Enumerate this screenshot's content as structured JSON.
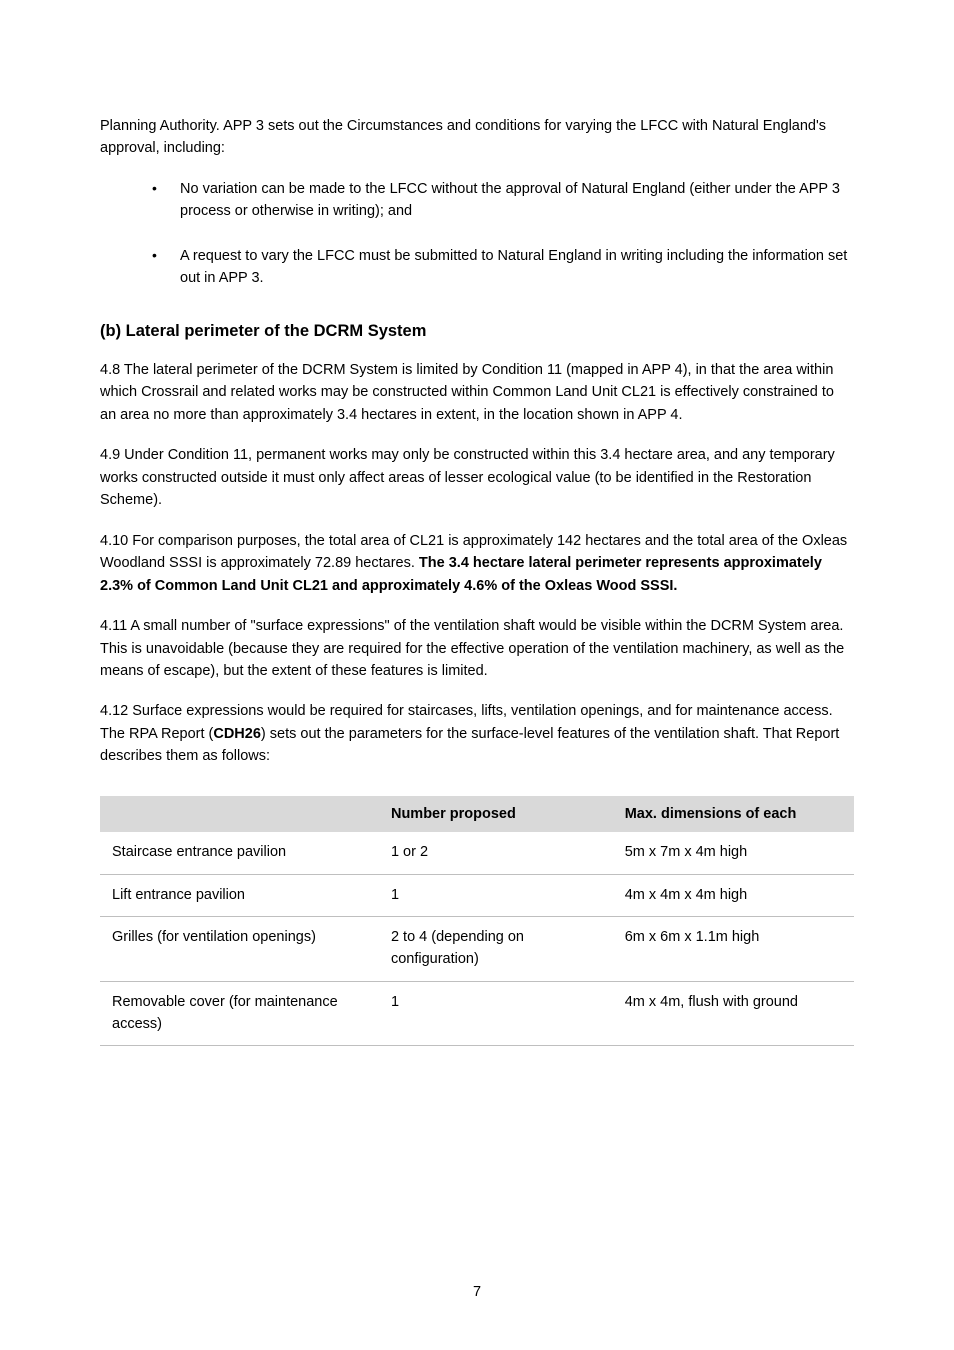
{
  "intro": "Planning Authority. APP 3 sets out the Circumstances and conditions for varying the LFCC with Natural England's approval, including:",
  "bullets": [
    "No variation can be made to the LFCC without the approval of Natural England (either under the APP 3 process or otherwise in writing); and",
    "A request to vary the LFCC must be submitted to Natural England in writing including the information set out in APP 3."
  ],
  "heading": "(b) Lateral perimeter of the DCRM System",
  "para1": "4.8 The lateral perimeter of the DCRM System is limited by Condition 11 (mapped in APP 4), in that the area within which Crossrail and related works may be constructed within Common Land Unit CL21 is effectively constrained to an area no more than approximately 3.4 hectares in extent, in the location shown in APP 4.",
  "para2": "4.9 Under Condition 11, permanent works may only be constructed within this 3.4 hectare area, and any temporary works constructed outside it must only affect areas of lesser ecological value (to be identified in the Restoration Scheme).",
  "para3_part1": "4.10 For comparison purposes, the total area of CL21 is approximately 142 hectares and the total area of the Oxleas Woodland SSSI is approximately 72.89 hectares. ",
  "para3_bold": "The 3.4 hectare lateral perimeter represents approximately 2.3% of Common Land Unit CL21 and approximately 4.6% of the Oxleas Wood SSSI.",
  "para4": "4.11 A small number of \"surface expressions\" of the ventilation shaft would be visible within the DCRM System area. This is unavoidable (because they are required for the effective operation of the ventilation machinery, as well as the means of escape), but the extent of these features is limited.",
  "para5_part1": "4.12 Surface expressions would be required for staircases, lifts, ventilation openings, and for maintenance access. The RPA Report (",
  "para5_bold": "CDH26",
  "para5_part2": ") sets out the parameters for the surface-level features of the ventilation shaft. That Report describes them as follows:",
  "table": {
    "headers": [
      "",
      "Number proposed",
      "Max. dimensions of each"
    ],
    "rows": [
      [
        "Staircase entrance pavilion",
        "1 or 2",
        "5m x 7m x 4m high"
      ],
      [
        "Lift entrance pavilion",
        "1",
        "4m x 4m x 4m high"
      ],
      [
        "Grilles (for ventilation openings)",
        "2 to 4 (depending on configuration)",
        "6m x 6m x 1.1m high"
      ],
      [
        "Removable cover (for maintenance access)",
        "1",
        "4m x 4m, flush with ground"
      ]
    ]
  },
  "page_number": "7"
}
